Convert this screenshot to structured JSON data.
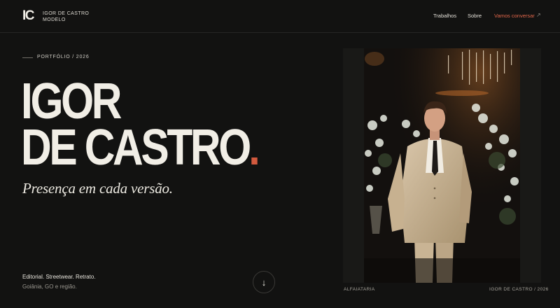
{
  "header": {
    "logo": "IC",
    "name_line1": "IGOR DE CASTRO",
    "name_line2": "MODELO",
    "nav": {
      "work": "Trabalhos",
      "about": "Sobre",
      "cta": "Vamos conversar",
      "cta_icon": "arrow-up-right-icon"
    }
  },
  "hero": {
    "eyebrow": "PORTFÓLIO / 2026",
    "title_line1": "IGOR",
    "title_line2": "DE CASTRO",
    "tagline": "Presença em cada versão.",
    "description": "Editorial. Streetwear. Retrato.",
    "location": "Goiânia, GO e região.",
    "scroll_icon": "arrow-down-icon",
    "scroll_glyph": "↓"
  },
  "photo": {
    "caption_left": "ALFAIATARIA",
    "caption_right": "IGOR DE CASTRO / 2026"
  },
  "colors": {
    "background": "#121211",
    "text": "#efece4",
    "accent": "#d35a3e"
  }
}
